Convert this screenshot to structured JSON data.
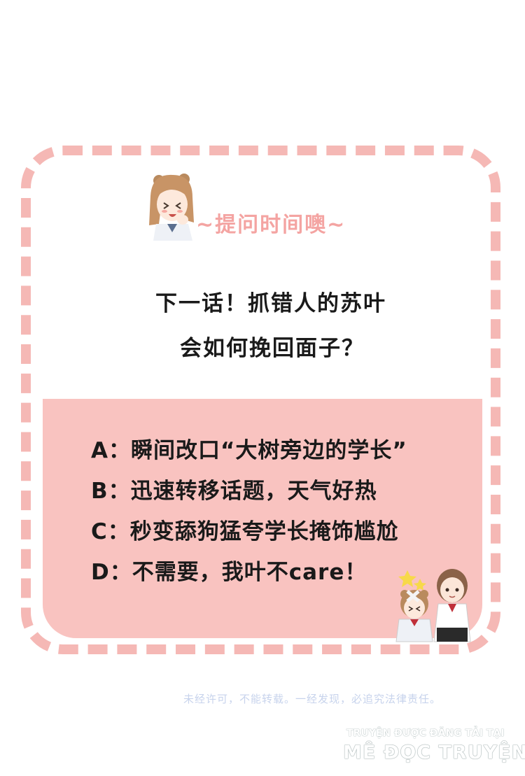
{
  "header": {
    "title": "~提问时间噢~"
  },
  "question": {
    "line1": "下一话！抓错人的苏叶",
    "line2": "会如何挽回面子？"
  },
  "options": [
    "A：瞬间改口“大树旁边的学长”",
    "B：迅速转移话题，天气好热",
    "C：秒变舔狗猛夸学长掩饰尴尬",
    "D：不需要，我叶不care！"
  ],
  "footer": {
    "notice": "未经许可，不能转载。一经发现，必追究法律责任。",
    "watermark_line1": "TRUYỆN ĐƯỢC ĐĂNG TẢI TẠI",
    "watermark_line2": "MÊ ĐỌC TRUYỆN"
  },
  "colors": {
    "accent_pink": "#f5b8b5",
    "panel_pink": "#f9c3c0",
    "title_pink": "#f4a4a2"
  }
}
